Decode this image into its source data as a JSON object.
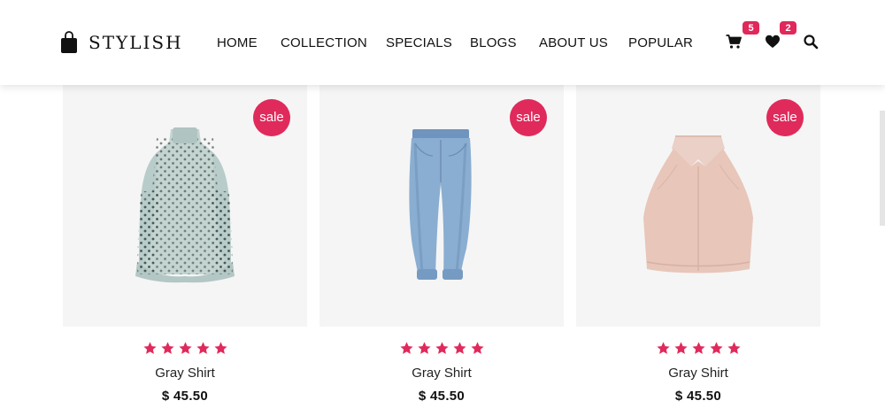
{
  "brand": {
    "name": "STYLISH",
    "logo_icon": "shopping-bag-icon"
  },
  "nav": {
    "items": [
      {
        "label": "HOME"
      },
      {
        "label": "COLLECTION"
      },
      {
        "label": "SPECIALS"
      },
      {
        "label": "BLOGS"
      },
      {
        "label": "ABOUT US"
      },
      {
        "label": "POPULAR"
      }
    ]
  },
  "header_icons": {
    "cart": {
      "icon": "cart-icon",
      "count": "5"
    },
    "wishlist": {
      "icon": "heart-icon",
      "count": "2"
    },
    "search": {
      "icon": "search-icon"
    }
  },
  "colors": {
    "accent": "#e02a5b",
    "card_bg": "#f5f5f5",
    "text": "#111111"
  },
  "products": [
    {
      "badge": "sale",
      "rating": 5,
      "name": "Gray Shirt",
      "price": "$ 45.50",
      "image": "polka-dot-dress"
    },
    {
      "badge": "sale",
      "rating": 5,
      "name": "Gray Shirt",
      "price": "$ 45.50",
      "image": "blue-jeans"
    },
    {
      "badge": "sale",
      "rating": 5,
      "name": "Gray Shirt",
      "price": "$ 45.50",
      "image": "pink-halter-top"
    }
  ]
}
